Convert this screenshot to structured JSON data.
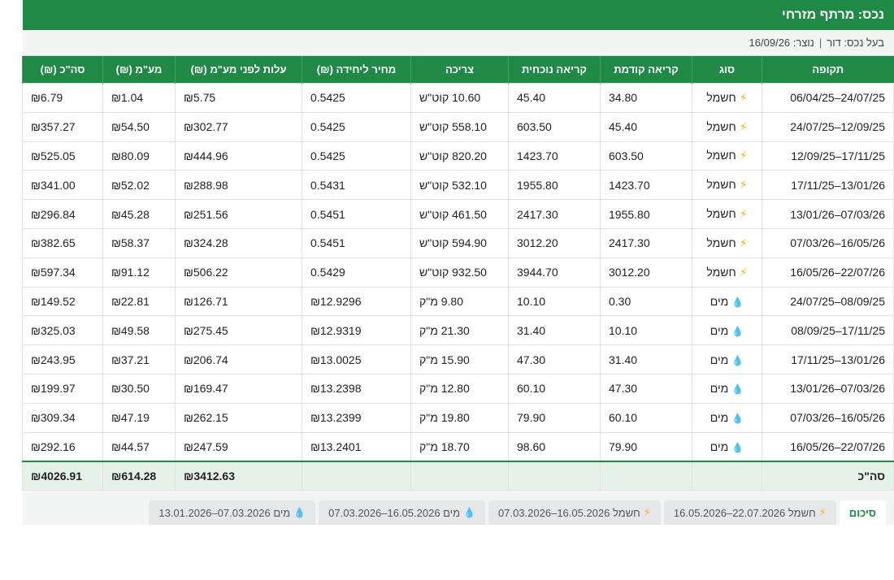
{
  "header": {
    "title": "נכס: מרתף מזרחי"
  },
  "subheader": {
    "owner": "בעל נכס: דור",
    "separator": "|",
    "created": "נוצר: 16/09/26"
  },
  "table": {
    "columns": [
      "תקופה",
      "סוג",
      "קריאה קודמת",
      "קריאה נוכחית",
      "צריכה",
      "מחיר ליחידה (₪)",
      "עלות לפני מע\"מ (₪)",
      "מע\"מ (₪)",
      "סה\"כ (₪)"
    ],
    "rows": [
      {
        "period": "24/07/25–06/04/25",
        "type": "חשמל",
        "icon": "bolt",
        "prev": "34.80",
        "curr": "45.40",
        "usage": "10.60 קוט\"ש",
        "unit": "0.5425",
        "pre_vat": "₪5.75",
        "vat": "₪1.04",
        "total": "₪6.79"
      },
      {
        "period": "12/09/25–24/07/25",
        "type": "חשמל",
        "icon": "bolt",
        "prev": "45.40",
        "curr": "603.50",
        "usage": "558.10 קוט\"ש",
        "unit": "0.5425",
        "pre_vat": "₪302.77",
        "vat": "₪54.50",
        "total": "₪357.27"
      },
      {
        "period": "17/11/25–12/09/25",
        "type": "חשמל",
        "icon": "bolt",
        "prev": "603.50",
        "curr": "1423.70",
        "usage": "820.20 קוט\"ש",
        "unit": "0.5425",
        "pre_vat": "₪444.96",
        "vat": "₪80.09",
        "total": "₪525.05"
      },
      {
        "period": "13/01/26–17/11/25",
        "type": "חשמל",
        "icon": "bolt",
        "prev": "1423.70",
        "curr": "1955.80",
        "usage": "532.10 קוט\"ש",
        "unit": "0.5431",
        "pre_vat": "₪288.98",
        "vat": "₪52.02",
        "total": "₪341.00"
      },
      {
        "period": "07/03/26–13/01/26",
        "type": "חשמל",
        "icon": "bolt",
        "prev": "1955.80",
        "curr": "2417.30",
        "usage": "461.50 קוט\"ש",
        "unit": "0.5451",
        "pre_vat": "₪251.56",
        "vat": "₪45.28",
        "total": "₪296.84"
      },
      {
        "period": "16/05/26–07/03/26",
        "type": "חשמל",
        "icon": "bolt",
        "prev": "2417.30",
        "curr": "3012.20",
        "usage": "594.90 קוט\"ש",
        "unit": "0.5451",
        "pre_vat": "₪324.28",
        "vat": "₪58.37",
        "total": "₪382.65"
      },
      {
        "period": "22/07/26–16/05/26",
        "type": "חשמל",
        "icon": "bolt",
        "prev": "3012.20",
        "curr": "3944.70",
        "usage": "932.50 קוט\"ש",
        "unit": "0.5429",
        "pre_vat": "₪506.22",
        "vat": "₪91.12",
        "total": "₪597.34"
      },
      {
        "period": "08/09/25–24/07/25",
        "type": "מים",
        "icon": "drop",
        "prev": "0.30",
        "curr": "10.10",
        "usage": "9.80 מ\"ק",
        "unit": "₪12.9296",
        "pre_vat": "₪126.71",
        "vat": "₪22.81",
        "total": "₪149.52"
      },
      {
        "period": "17/11/25–08/09/25",
        "type": "מים",
        "icon": "drop",
        "prev": "10.10",
        "curr": "31.40",
        "usage": "21.30 מ\"ק",
        "unit": "₪12.9319",
        "pre_vat": "₪275.45",
        "vat": "₪49.58",
        "total": "₪325.03"
      },
      {
        "period": "13/01/26–17/11/25",
        "type": "מים",
        "icon": "drop",
        "prev": "31.40",
        "curr": "47.30",
        "usage": "15.90 מ\"ק",
        "unit": "₪13.0025",
        "pre_vat": "₪206.74",
        "vat": "₪37.21",
        "total": "₪243.95"
      },
      {
        "period": "07/03/26–13/01/26",
        "type": "מים",
        "icon": "drop",
        "prev": "47.30",
        "curr": "60.10",
        "usage": "12.80 מ\"ק",
        "unit": "₪13.2398",
        "pre_vat": "₪169.47",
        "vat": "₪30.50",
        "total": "₪199.97"
      },
      {
        "period": "16/05/26–07/03/26",
        "type": "מים",
        "icon": "drop",
        "prev": "60.10",
        "curr": "79.90",
        "usage": "19.80 מ\"ק",
        "unit": "₪13.2399",
        "pre_vat": "₪262.15",
        "vat": "₪47.19",
        "total": "₪309.34"
      },
      {
        "period": "22/07/26–16/05/26",
        "type": "מים",
        "icon": "drop",
        "prev": "79.90",
        "curr": "98.60",
        "usage": "18.70 מ\"ק",
        "unit": "₪13.2401",
        "pre_vat": "₪247.59",
        "vat": "₪44.57",
        "total": "₪292.16"
      }
    ],
    "totals": {
      "label": "סה\"כ",
      "pre_vat": "₪3412.63",
      "vat": "₪614.28",
      "total": "₪4026.91"
    }
  },
  "tabs": [
    {
      "label": "סיכום",
      "active": true,
      "icon": null
    },
    {
      "label": "חשמל 22.07.2026–16.05.2026",
      "active": false,
      "icon": "bolt"
    },
    {
      "label": "חשמל 16.05.2026–07.03.2026",
      "active": false,
      "icon": "bolt"
    },
    {
      "label": "מים 16.05.2026–07.03.2026",
      "active": false,
      "icon": "drop"
    },
    {
      "label": "מים 07.03.2026–13.01.2026",
      "active": false,
      "icon": "drop"
    }
  ],
  "colors": {
    "accent": "#1f8a45",
    "bolt": "#f2b20f",
    "drop": "#1f8fe0",
    "total_bg": "#e5f2e8"
  },
  "icons": {
    "bolt": "⚡",
    "drop": "💧"
  }
}
